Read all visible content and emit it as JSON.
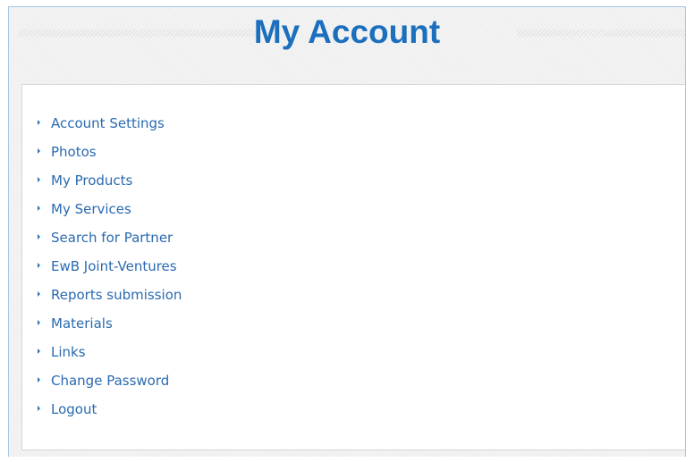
{
  "page": {
    "title": "My Account"
  },
  "menu": {
    "items": [
      {
        "label": "Account Settings",
        "icon": "bullet-arrow-icon"
      },
      {
        "label": "Photos",
        "icon": "bullet-arrow-icon"
      },
      {
        "label": "My Products",
        "icon": "bullet-arrow-icon"
      },
      {
        "label": "My Services",
        "icon": "bullet-arrow-icon"
      },
      {
        "label": "Search for Partner",
        "icon": "bullet-arrow-icon"
      },
      {
        "label": "EwB Joint-Ventures",
        "icon": "bullet-arrow-icon"
      },
      {
        "label": "Reports submission",
        "icon": "bullet-arrow-icon"
      },
      {
        "label": "Materials",
        "icon": "bullet-arrow-icon"
      },
      {
        "label": "Links",
        "icon": "bullet-arrow-icon"
      },
      {
        "label": "Change Password",
        "icon": "bullet-arrow-icon"
      },
      {
        "label": "Logout",
        "icon": "bullet-arrow-icon"
      }
    ]
  },
  "colors": {
    "title": "#1b6fbd",
    "link": "#2a6ab0",
    "frame_border": "#a8c6e6",
    "panel_border": "#d6d6d6"
  }
}
